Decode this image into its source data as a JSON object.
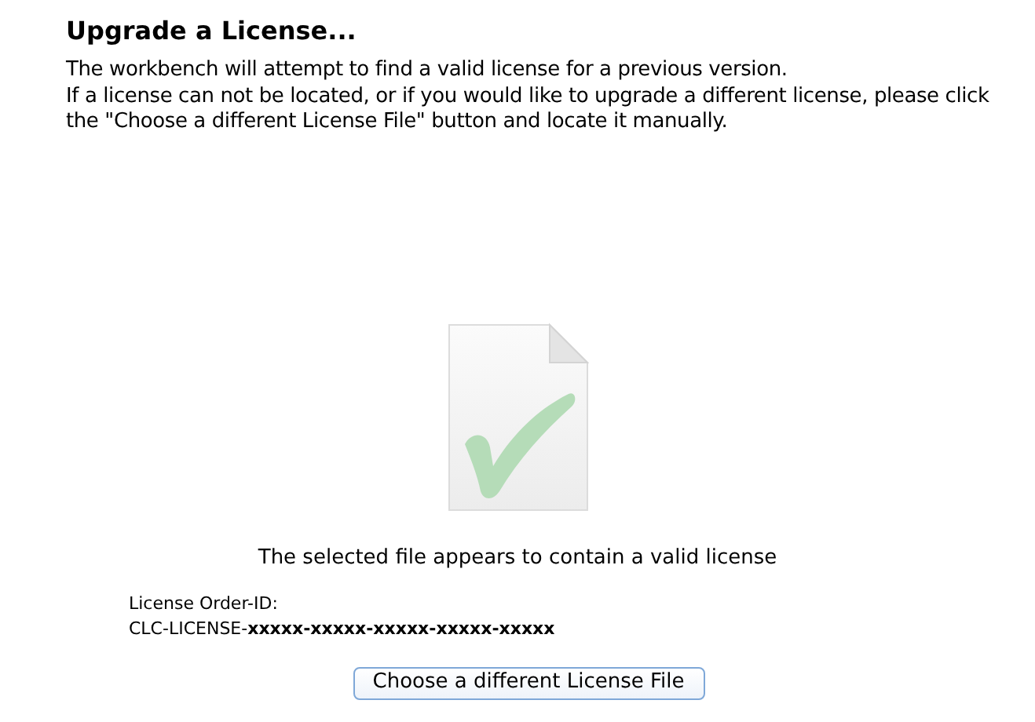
{
  "title": "Upgrade a License...",
  "paragraphs": [
    "The workbench will attempt to find a valid license for a previous version.",
    "If a license can not be located, or if you would like to upgrade a different license, please click the \"Choose a different License File\" button and locate it manually."
  ],
  "file_status": {
    "message": "The selected file appears to contain a valid license"
  },
  "order_id": {
    "label": "License Order-ID:",
    "value": "CLC-LICENSE-**xxxxx-xxxxx-xxxxx-xxxxx-xxxxx**"
  },
  "button": "Choose a different License File"
}
